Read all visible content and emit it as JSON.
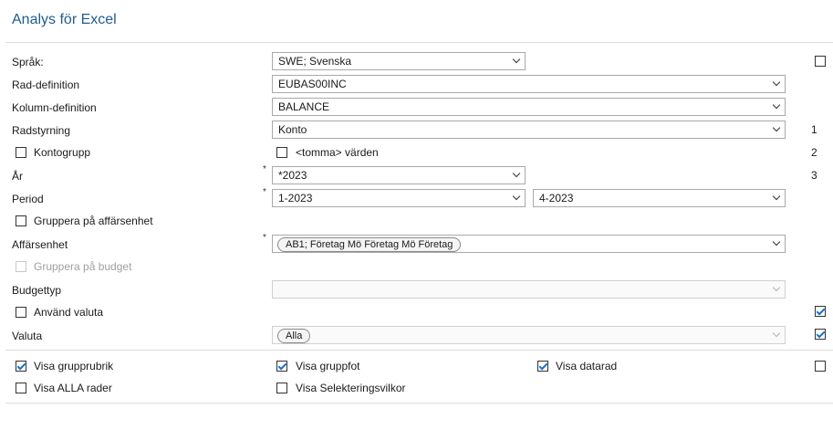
{
  "title": "Analys för Excel",
  "fields": {
    "sprak": {
      "label": "Språk:",
      "value": "SWE; Svenska"
    },
    "rad_definition": {
      "label": "Rad-definition",
      "value": "EUBAS00INC"
    },
    "kolumn_definition": {
      "label": "Kolumn-definition",
      "value": "BALANCE"
    },
    "radstyrning": {
      "label": "Radstyrning",
      "value": "Konto",
      "index": "1"
    },
    "kontogrupp": {
      "label": "Kontogrupp",
      "checked": false
    },
    "tomma_varden": {
      "label": "<tomma> värden",
      "checked": false,
      "index": "2"
    },
    "ar": {
      "label": "År",
      "value": "*2023",
      "required": "*",
      "index": "3"
    },
    "period": {
      "label": "Period",
      "from": "1-2023",
      "to": "4-2023",
      "required": "*"
    },
    "gruppera_affarsenhet": {
      "label": "Gruppera på affärsenhet",
      "checked": false
    },
    "affarsenhet": {
      "label": "Affärsenhet",
      "tag": "AB1; Företag Mö Företag Mö Företag",
      "required": "*"
    },
    "gruppera_budget": {
      "label": "Gruppera på budget",
      "checked": false,
      "disabled": true
    },
    "budgettyp": {
      "label": "Budgettyp",
      "value": ""
    },
    "anvand_valuta": {
      "label": "Använd valuta",
      "checked": false
    },
    "valuta": {
      "label": "Valuta",
      "tag": "Alla"
    }
  },
  "display_options": {
    "visa_grupprubrik": {
      "label": "Visa grupprubrik",
      "checked": true
    },
    "visa_gruppfot": {
      "label": "Visa gruppfot",
      "checked": true
    },
    "visa_datarad": {
      "label": "Visa datarad",
      "checked": true
    },
    "visa_alla_rader": {
      "label": "Visa ALLA rader",
      "checked": false
    },
    "visa_selekteringsvilkor": {
      "label": "Visa Selekteringsvilkor",
      "checked": false
    }
  },
  "right_checkboxes": {
    "sprak": false,
    "anvand_valuta": true,
    "valuta": true,
    "display": false
  },
  "colors": {
    "title": "#1f5c8f",
    "check": "#1a73c8"
  }
}
